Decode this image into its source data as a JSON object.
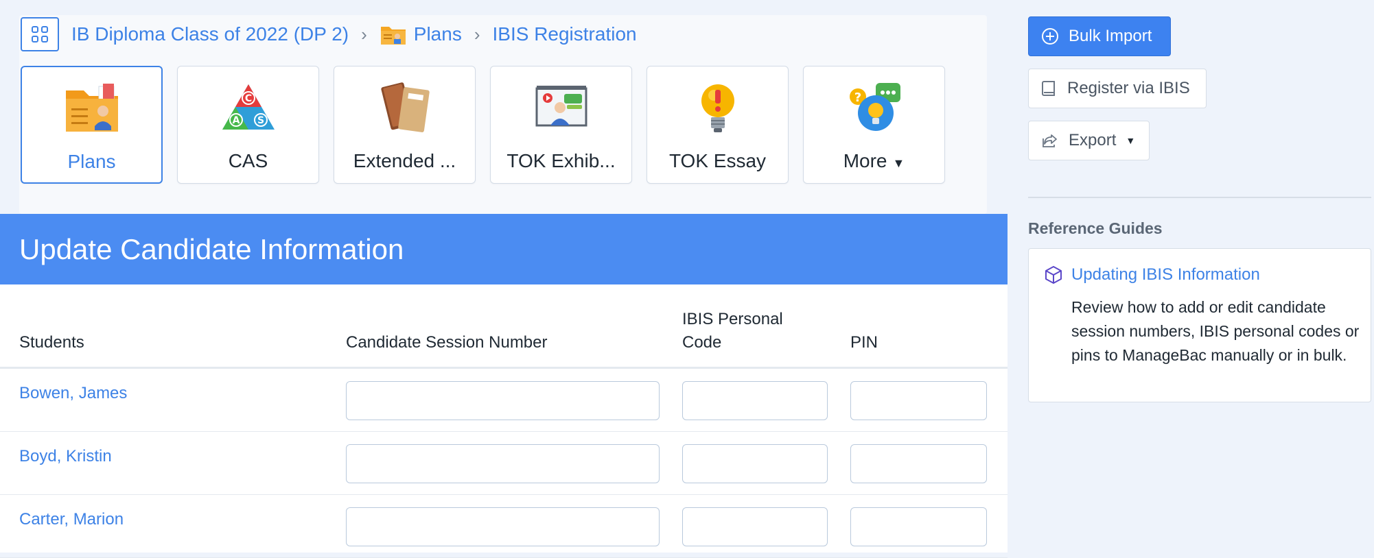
{
  "breadcrumb": {
    "items": [
      "IB Diploma Class of 2022 (DP 2)",
      "Plans",
      "IBIS Registration"
    ],
    "separator": "›"
  },
  "tiles": [
    {
      "label": "Plans",
      "icon": "plans-folder-icon",
      "active": true
    },
    {
      "label": "CAS",
      "icon": "cas-triangle-icon",
      "active": false
    },
    {
      "label": "Extended ...",
      "icon": "extended-essay-books-icon",
      "active": false
    },
    {
      "label": "TOK Exhib...",
      "icon": "tok-exhibition-presentation-icon",
      "active": false
    },
    {
      "label": "TOK Essay",
      "icon": "tok-essay-lightbulb-icon",
      "active": false
    },
    {
      "label": "More",
      "icon": "more-bubbles-icon",
      "active": false
    }
  ],
  "main": {
    "title": "Update Candidate Information",
    "columns": [
      "Students",
      "Candidate Session Number",
      "IBIS Personal Code",
      "PIN"
    ],
    "rows": [
      {
        "student": "Bowen, James",
        "session_number": "",
        "personal_code": "",
        "pin": ""
      },
      {
        "student": "Boyd, Kristin",
        "session_number": "",
        "personal_code": "",
        "pin": ""
      },
      {
        "student": "Carter, Marion",
        "session_number": "",
        "personal_code": "",
        "pin": ""
      }
    ]
  },
  "actions": {
    "bulk_import": "Bulk Import",
    "register_ibis": "Register via IBIS",
    "export": "Export"
  },
  "reference": {
    "heading": "Reference Guides",
    "link": "Updating IBIS Information",
    "description": "Review how to add or edit candidate session numbers, IBIS personal codes or pins to ManageBac manually or in bulk."
  },
  "colors": {
    "accent": "#3d82e6",
    "banner": "#4b8cf2",
    "background": "#eef3fb"
  }
}
